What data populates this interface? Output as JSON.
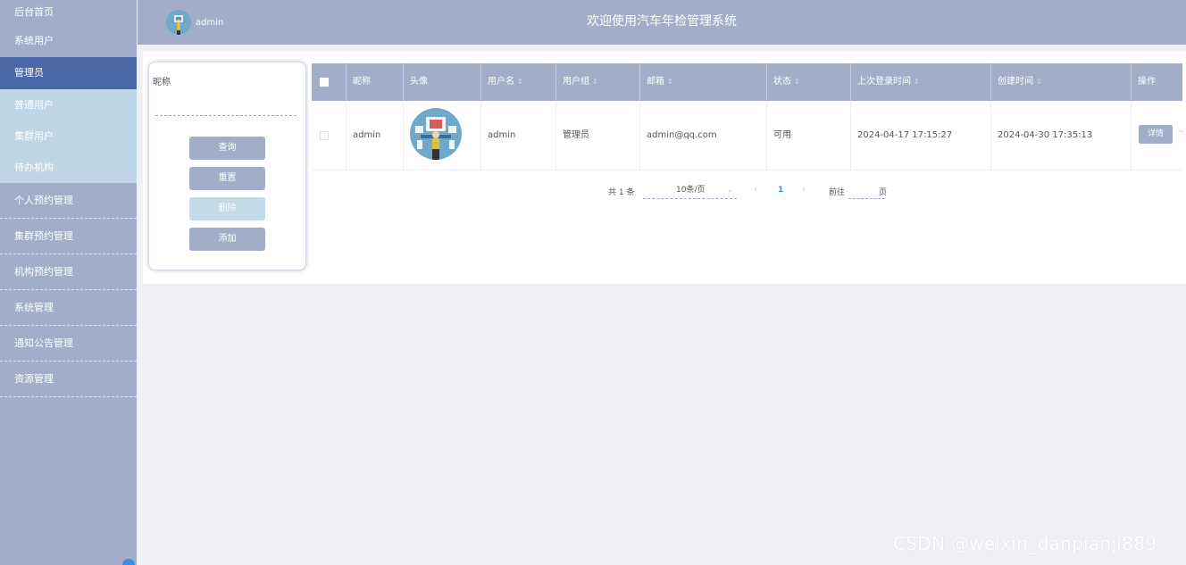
{
  "sidebar": {
    "home": "后台首页",
    "system_users": "系统用户",
    "admin": "管理员",
    "sub_items": [
      "普通用户",
      "集群用户",
      "待办机构"
    ],
    "groups": [
      "个人预约管理",
      "集群预约管理",
      "机构预约管理",
      "系统管理",
      "通知公告管理",
      "资源管理"
    ]
  },
  "header": {
    "username": "admin",
    "title": "欢迎使用汽车年检管理系统"
  },
  "search": {
    "label": "昵称",
    "value": "",
    "query_label": "查询",
    "reset_label": "重置",
    "delete_label": "删除",
    "add_label": "添加"
  },
  "table": {
    "columns": [
      "昵称",
      "头像",
      "用户名",
      "用户组",
      "邮箱",
      "状态",
      "上次登录时间",
      "创建时间",
      "操作"
    ],
    "sort_icon": "⇕",
    "rows": [
      {
        "nickname": "admin",
        "username": "admin",
        "group": "管理员",
        "email": "admin@qq.com",
        "status": "可用",
        "last_login": "2024-04-17 17:15:27",
        "created": "2024-04-30 17:35:13",
        "action": "详情"
      }
    ]
  },
  "pagination": {
    "total": "共 1 条",
    "page_size": "10条/页",
    "prev": "‹",
    "current": "1",
    "next": "›",
    "goto": "前往",
    "page_unit": "页"
  },
  "watermark": "CSDN @weixin_danpianji889",
  "colors": {
    "primary": "#a3adc9",
    "active": "#4a68a8",
    "submenu": "#bed6e6",
    "page_bg": "#f0eff5",
    "link": "#3c8de8"
  }
}
